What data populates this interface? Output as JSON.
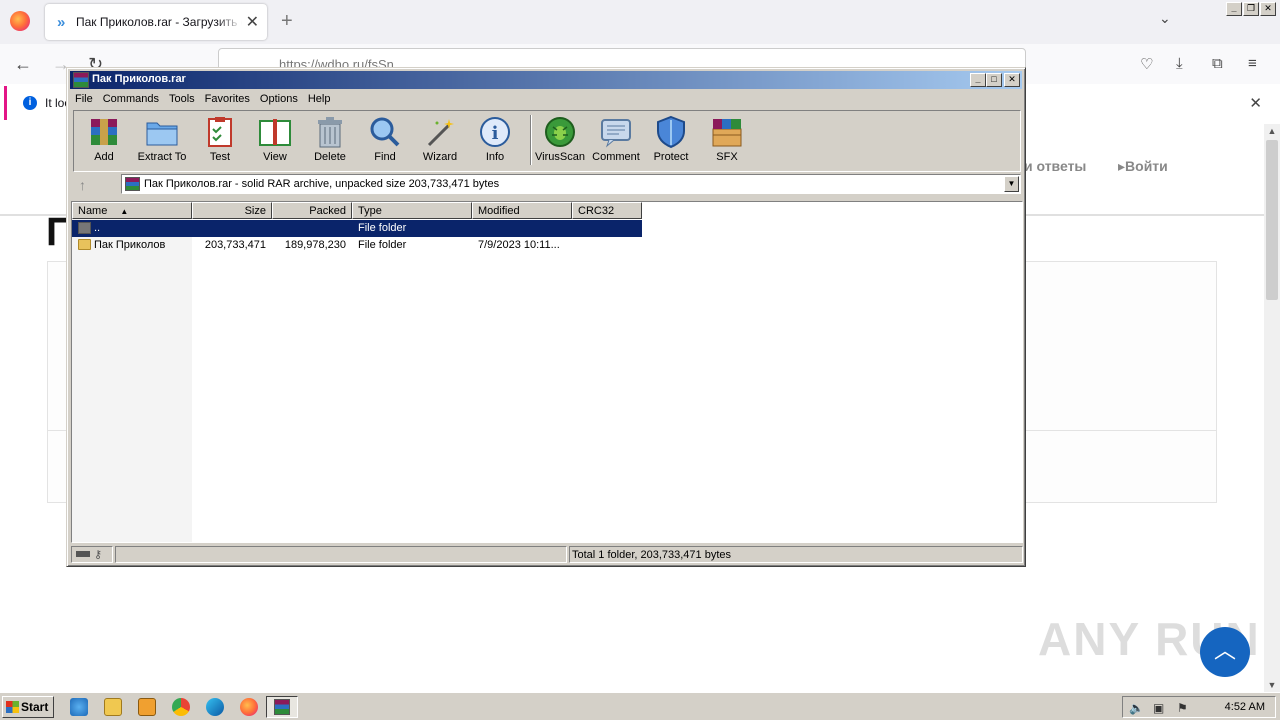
{
  "browser": {
    "tab_title": "Пак Приколов.rar - Загрузить файл",
    "url": "https://wdho.ru/fsSn",
    "notice_text": "It loo"
  },
  "webpage": {
    "nav_faq": "и ответы",
    "nav_login": "Войти",
    "big_title_fragment": "П"
  },
  "watermark": "ANY RUN",
  "winrar": {
    "title": "Пак Приколов.rar",
    "menu": [
      "File",
      "Commands",
      "Tools",
      "Favorites",
      "Options",
      "Help"
    ],
    "toolbar": [
      {
        "label": "Add",
        "icon": "add-archive-icon"
      },
      {
        "label": "Extract To",
        "icon": "extract-folder-icon"
      },
      {
        "label": "Test",
        "icon": "test-clipboard-icon"
      },
      {
        "label": "View",
        "icon": "view-book-icon"
      },
      {
        "label": "Delete",
        "icon": "trash-can-icon"
      },
      {
        "label": "Find",
        "icon": "magnifier-icon"
      },
      {
        "label": "Wizard",
        "icon": "magic-wand-icon"
      },
      {
        "label": "Info",
        "icon": "info-icon"
      },
      {
        "label": "VirusScan",
        "icon": "virus-scan-icon"
      },
      {
        "label": "Comment",
        "icon": "comment-icon"
      },
      {
        "label": "Protect",
        "icon": "shield-icon"
      },
      {
        "label": "SFX",
        "icon": "sfx-box-icon"
      }
    ],
    "path_text": "Пак Приколов.rar - solid RAR archive, unpacked size 203,733,471 bytes",
    "columns": [
      "Name",
      "Size",
      "Packed",
      "Type",
      "Modified",
      "CRC32"
    ],
    "rows": [
      {
        "name": "..",
        "size": "",
        "packed": "",
        "type": "File folder",
        "modified": "",
        "crc": ""
      },
      {
        "name": "Пак Приколов",
        "size": "203,733,471",
        "packed": "189,978,230",
        "type": "File folder",
        "modified": "7/9/2023 10:11...",
        "crc": ""
      }
    ],
    "status_text": "Total 1 folder, 203,733,471 bytes"
  },
  "taskbar": {
    "start_label": "Start",
    "clock": "4:52 AM"
  }
}
